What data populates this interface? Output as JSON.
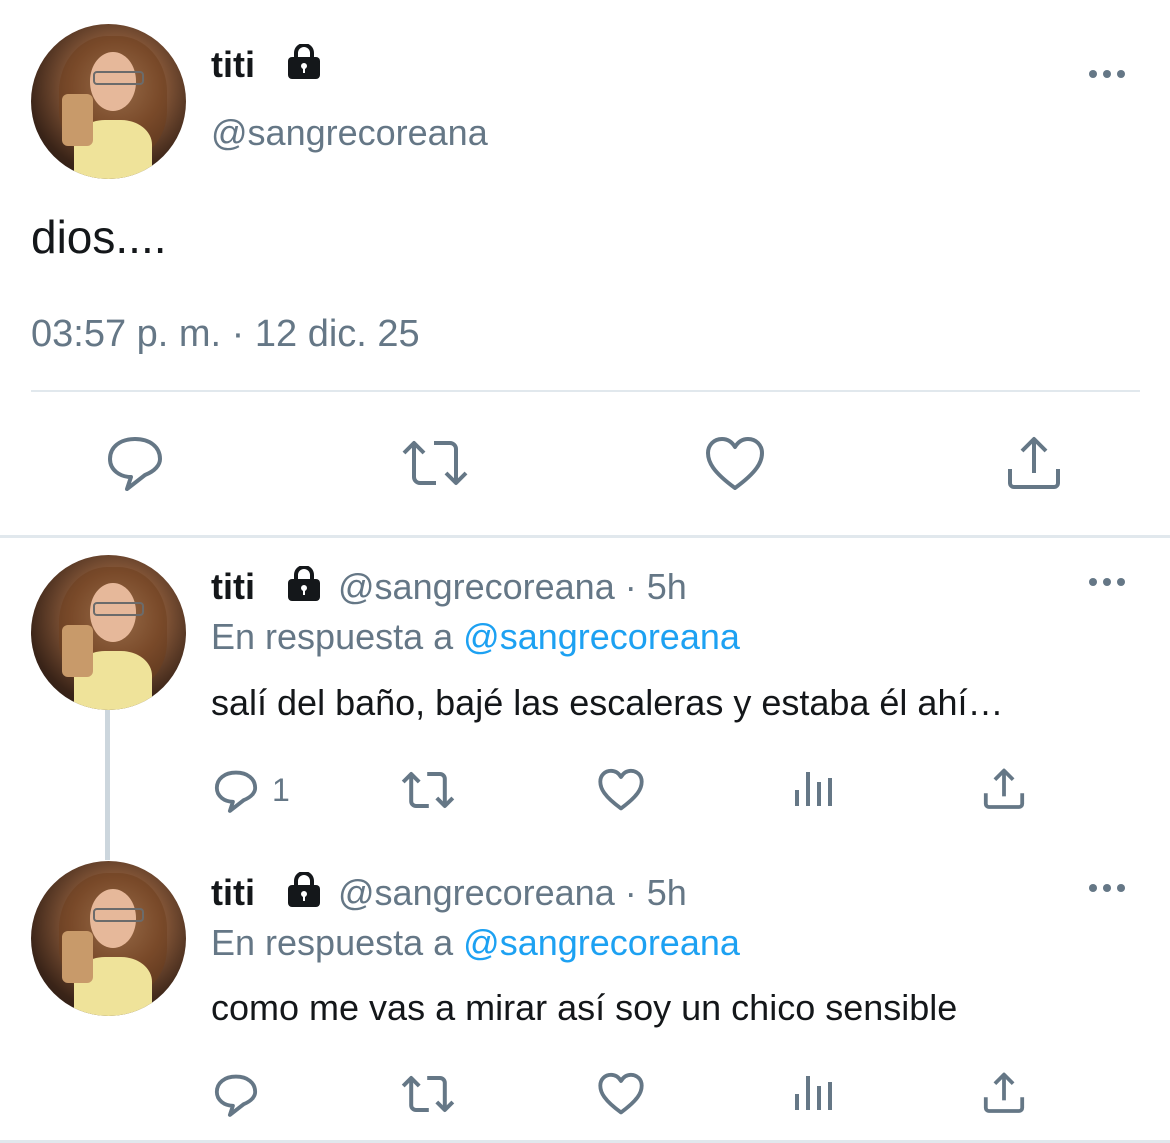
{
  "main_tweet": {
    "name": "titi",
    "handle": "@sangrecoreana",
    "text": "dios....",
    "timestamp": "03:57 p. m. · 12 dic. 25",
    "locked": true
  },
  "replies": [
    {
      "name": "titi",
      "handle_meta": "@sangrecoreana · 5h",
      "reply_prefix": "En respuesta a",
      "reply_to": "@sangrecoreana",
      "text": "salí del baño, bajé las escaleras y estaba él ahí…",
      "reply_count": "1"
    },
    {
      "name": "titi",
      "handle_meta": "@sangrecoreana · 5h",
      "reply_prefix": "En respuesta a",
      "reply_to": "@sangrecoreana",
      "text": "como me vas a mirar así soy un chico sensible",
      "reply_count": ""
    }
  ],
  "icons": {
    "lock": "lock-icon",
    "more": "more-icon",
    "reply": "reply-icon",
    "retweet": "retweet-icon",
    "like": "like-icon",
    "analytics": "analytics-icon",
    "share": "share-icon"
  },
  "colors": {
    "text": "#14171a",
    "muted": "#657786",
    "link": "#1da1f2",
    "divider": "#e1e8ed"
  }
}
